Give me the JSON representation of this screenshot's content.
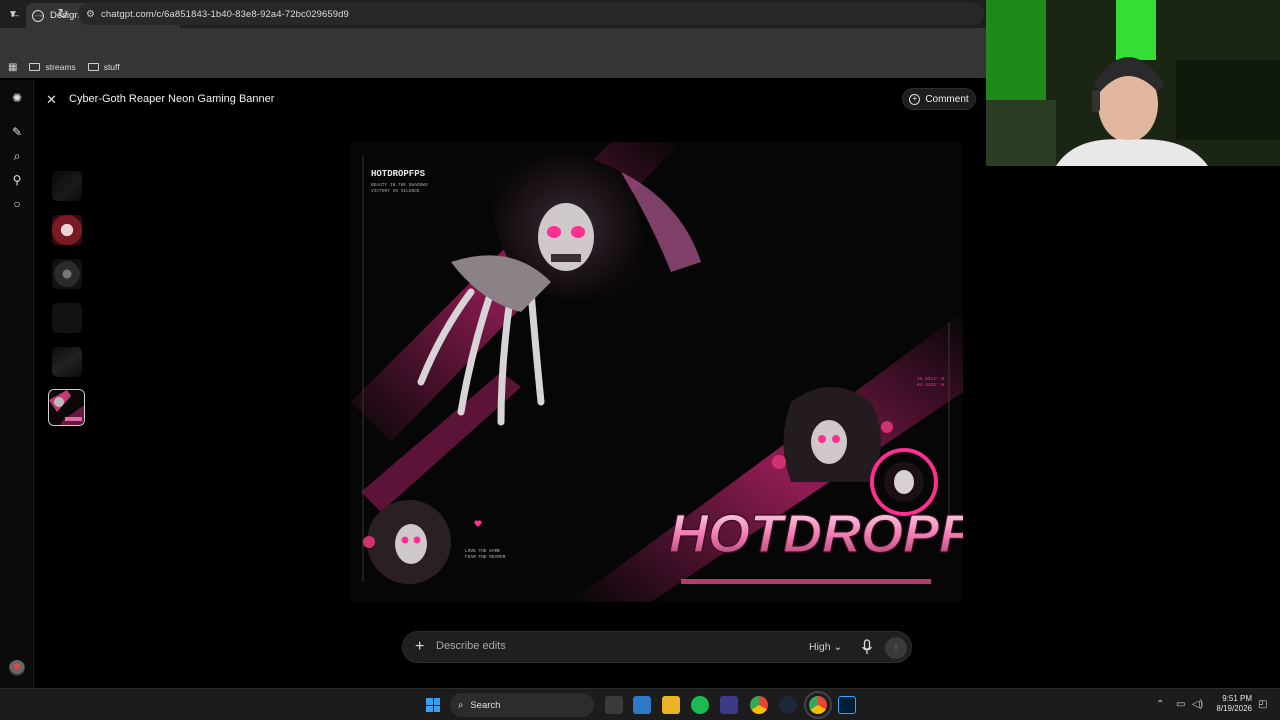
{
  "browser": {
    "tab_title": "Design Logo Sticker",
    "url": "chatgpt.com/c/6a851843-1b40-83e8-92a4-72bc029659d9",
    "bookmarks": [
      "streams",
      "stuff"
    ]
  },
  "viewer": {
    "title": "Cyber-Goth Reaper Neon Gaming Banner",
    "comment_label": "Comment"
  },
  "prompt": {
    "placeholder": "Describe edits",
    "quality": "High"
  },
  "image": {
    "brand": "HOTDROPFPS",
    "big_logo": "HOTDROPFPS",
    "tagline_1": "BEAUTY IN THE SHADOWS",
    "tagline_2": "VICTORY IN SILENCE",
    "small_text_1": "LOVE THE GAME",
    "small_text_2": "FEAR THE REAPER",
    "coords_1": "35.0622° N",
    "coords_2": "84.3432° W"
  },
  "taskbar": {
    "search_label": "Search",
    "time": "9:51 PM",
    "date": "8/19/2026"
  },
  "colors": {
    "neon_pink": "#ff2f92",
    "accent_blue": "#3aa0f0",
    "webcam_green": "#39ff3a"
  }
}
